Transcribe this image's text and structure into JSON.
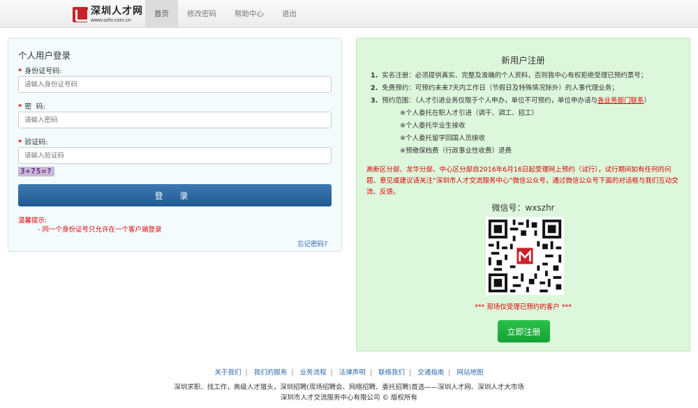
{
  "header": {
    "logo_cn": "深圳人才网",
    "logo_url": "www.szhr.com.cn",
    "nav": [
      "首页",
      "修改密码",
      "帮助中心",
      "退出"
    ]
  },
  "login": {
    "title": "个人用户登录",
    "id_label": "身份证号码:",
    "id_placeholder": "请输入身份证号码",
    "pwd_label": "密  码:",
    "pwd_placeholder": "请输入密码",
    "code_label": "验证码:",
    "code_placeholder": "请输入验证码",
    "captcha": "3+75=?",
    "button": "登 录",
    "tip_title": "温馨提示:",
    "tip_line": "- 同一个身份证号只允许在一个客户端登录",
    "forgot": "忘记密码?"
  },
  "register": {
    "title": "新用户注册",
    "rule1_num": "1.",
    "rule1": "实名注册：必须提供真实、完整及准确的个人资料，否则我中心有权拒绝受理已预约票号；",
    "rule2_num": "2.",
    "rule2": "免费预约：可预约未来7天内工作日（节假日及特殊情况除外）的人事代理业务；",
    "rule3_num": "3.",
    "rule3": "预约范围：（人才引进业务仅限于个人申办，单位不可预约，单位申办请与",
    "rule3_link": "各业务部门联系",
    "rule3_end": "）",
    "subs": [
      "※个人委托在职人才引进（调干、调工、招工）",
      "※个人委托毕业生接收",
      "※个人委托留学回国人员接收",
      "※预缴保档费（行政事业性收费）退费"
    ],
    "notice": "高新区分部、龙华分部、中心区分部自2016年6月16日起受理网上预约（试行），试行期间如有任何的问题、意见或建议请关注“深圳市人才交流服务中心”微信公众号，通过微信公众号下面的对话框与我们互动交流、反馈。",
    "wechat": "微信号：wxszhr",
    "qr_note": "*** 现场仅受理已预约的客户 ***",
    "button": "立即注册"
  },
  "footer": {
    "links": [
      "关于我们",
      "我们的服务",
      "业务流程",
      "法律声明",
      "联络我们",
      "交通指南",
      "网站地图"
    ],
    "line1": "深圳求职、找工作，高级人才猎头，深圳招聘(现场招聘会、网络招聘、委托招聘)首选——深圳人才网、深圳人才大市场",
    "line2": "深圳市人才交流服务中心有限公司 © 版权所有"
  },
  "colors": {
    "accent_blue": "#205a92",
    "register_green": "#14a233",
    "warning_red": "#dd0000",
    "logo_red": "#c8232a"
  },
  "icons": {
    "logo": "szhr-logo-icon",
    "qr": "wechat-qr-code"
  }
}
